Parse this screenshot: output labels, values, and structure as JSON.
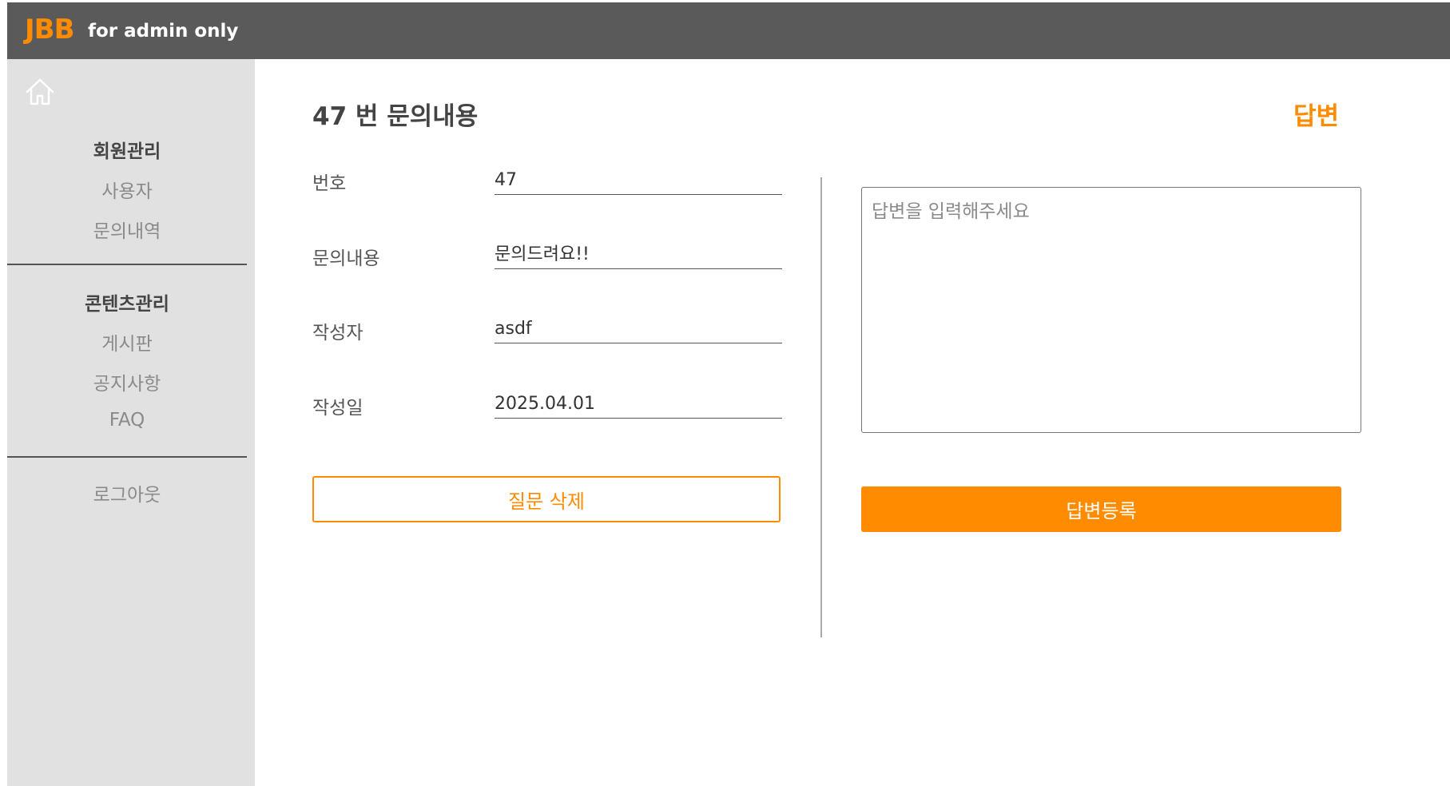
{
  "header": {
    "logo": "JBB",
    "tagline": "for admin only"
  },
  "sidebar": {
    "home_icon": "home-icon",
    "sections": [
      {
        "title": "회원관리",
        "items": [
          "사용자",
          "문의내역"
        ]
      },
      {
        "title": "콘텐츠관리",
        "items": [
          "게시판",
          "공지사항",
          "FAQ"
        ]
      }
    ],
    "logout": "로그아웃"
  },
  "inquiry": {
    "title": "47 번 문의내용",
    "fields": [
      {
        "label": "번호",
        "value": "47"
      },
      {
        "label": "문의내용",
        "value": "문의드려요!!"
      },
      {
        "label": "작성자",
        "value": "asdf"
      },
      {
        "label": "작성일",
        "value": "2025.04.01"
      }
    ],
    "delete_label": "질문 삭제"
  },
  "answer": {
    "title": "답변",
    "placeholder": "답변을 입력해주세요",
    "value": "",
    "submit_label": "답변등록"
  },
  "colors": {
    "accent": "#ff8c00",
    "topbar": "#5a5a5a",
    "sidebar": "#e1e1e1"
  }
}
